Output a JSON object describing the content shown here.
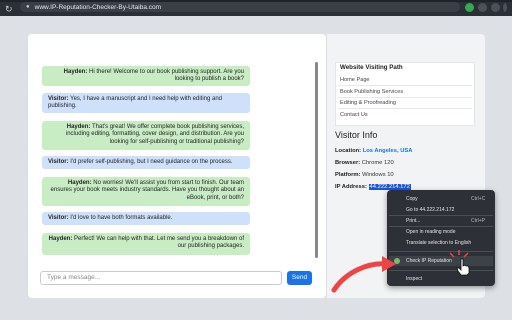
{
  "browser": {
    "url": "www.IP-Reputation-Checker-By-Utaiba.com"
  },
  "chat": {
    "messages": [
      {
        "sender": "Hayden:",
        "text": "Hi there! Welcome to our book publishing support. Are you looking to publish a book?",
        "role": "agent"
      },
      {
        "sender": "Visitor:",
        "text": "Yes, I have a manuscript and I need help with editing and publishing.",
        "role": "visitor"
      },
      {
        "sender": "Hayden:",
        "text": "That's great! We offer complete book publishing services, including editing, formatting, cover design, and distribution. Are you looking for self-publishing or traditional publishing?",
        "role": "agent"
      },
      {
        "sender": "Visitor:",
        "text": "I'd prefer self-publishing, but I need guidance on the process.",
        "role": "visitor"
      },
      {
        "sender": "Hayden:",
        "text": "No worries! We'll assist you from start to finish. Our team ensures your book meets industry standards. Have you thought about an eBook, print, or both?",
        "role": "agent"
      },
      {
        "sender": "Visitor:",
        "text": "I'd love to have both formats available.",
        "role": "visitor"
      },
      {
        "sender": "Hayden:",
        "text": "Perfect! We can help with that. Let me send you a breakdown of our publishing packages.",
        "role": "agent"
      }
    ],
    "input_placeholder": "Type a message...",
    "send_label": "Send"
  },
  "sidebar": {
    "path_title": "Website Visiting Path",
    "path_items": [
      "Home Page",
      "Book Publishing Services",
      "Editing & Proofreading",
      "Contact Us"
    ],
    "visitor_title": "Visitor Info",
    "location_label": "Location:",
    "location_value": "Los Angeles, USA",
    "browser_label": "Browser:",
    "browser_value": "Chrome 120",
    "platform_label": "Platform:",
    "platform_value": "Windows 10",
    "ip_label": "IP Address:",
    "ip_value": "44.222.214.172"
  },
  "context_menu": {
    "items": [
      {
        "label": "Copy",
        "shortcut": "Ctrl+C"
      },
      {
        "label": "Go to 44.222.214.172",
        "shortcut": ""
      },
      {
        "label": "Print...",
        "shortcut": "Ctrl+P"
      },
      {
        "label": "Open in reading mode",
        "shortcut": ""
      },
      {
        "label": "Translate selection to English",
        "shortcut": ""
      },
      {
        "label": "Check IP Reputation",
        "shortcut": ""
      },
      {
        "label": "Inspect",
        "shortcut": ""
      }
    ]
  },
  "colors": {
    "agent_bubble": "#c8ecc4",
    "visitor_bubble": "#cfe0fb",
    "accent": "#1a73e8",
    "arrow": "#ef4444"
  }
}
